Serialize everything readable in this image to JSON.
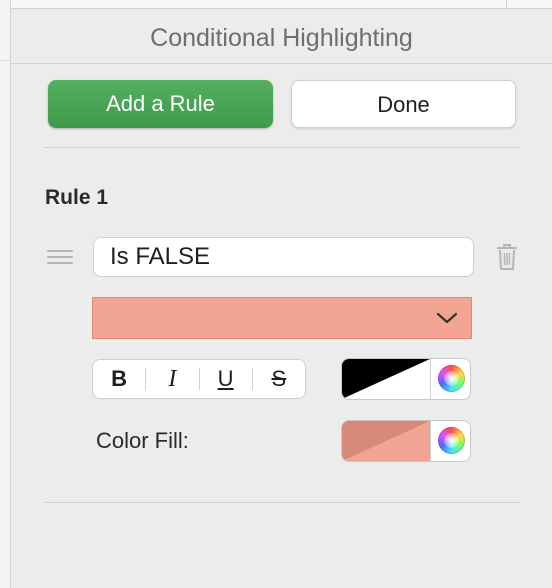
{
  "header": {
    "title": "Conditional Highlighting"
  },
  "actions": {
    "add_rule_label": "Add a Rule",
    "done_label": "Done"
  },
  "rule": {
    "title": "Rule 1",
    "condition_value": "Is FALSE",
    "style_preset_color": "#f2a593",
    "format_buttons": {
      "bold": "B",
      "italic": "I",
      "underline": "U",
      "strikethrough": "S"
    },
    "text_color": {
      "primary": "#000000",
      "secondary": "#ffffff"
    },
    "fill_label": "Color Fill:",
    "fill_color": {
      "primary": "#d88a78",
      "secondary": "#f2a593"
    }
  },
  "colors": {
    "accent_green": "#4aa657"
  }
}
